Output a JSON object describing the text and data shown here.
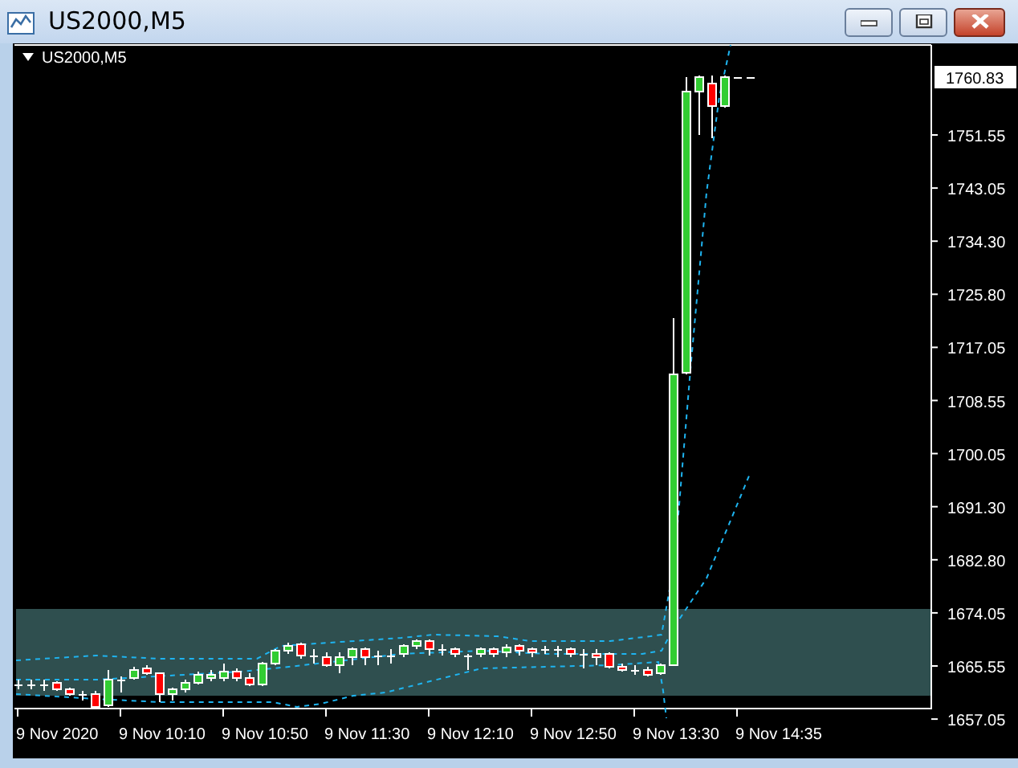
{
  "window": {
    "title": "US2000,M5"
  },
  "chart": {
    "label": "US2000,M5",
    "current_price": "1760.83",
    "price_axis": [
      "1751.55",
      "1743.05",
      "1734.30",
      "1725.80",
      "1717.05",
      "1708.55",
      "1700.05",
      "1691.30",
      "1682.80",
      "1674.05",
      "1665.55",
      "1657.05"
    ],
    "time_axis": [
      "9 Nov 2020",
      "9 Nov 10:10",
      "9 Nov 10:50",
      "9 Nov 11:30",
      "9 Nov 12:10",
      "9 Nov 12:50",
      "9 Nov 13:30",
      "9 Nov 14:35"
    ]
  }
}
